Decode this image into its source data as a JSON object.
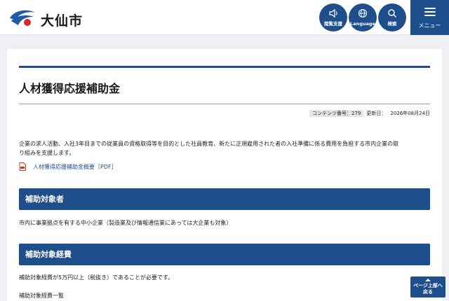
{
  "header": {
    "site_name": "大仙市",
    "buttons": {
      "reading_support": "閲覧支援",
      "language": "Language",
      "search": "検索",
      "menu": "メニュー"
    }
  },
  "page": {
    "title": "人材獲得応援補助金",
    "content_number_label": "コンテンツ番号：279",
    "updated_label": "更新日：",
    "updated_date": "2026年08月24日",
    "intro_line1": "企業の求人活動、入社3年目までの従業員の資格取得等を目的とした社員教育、新たに正規雇用された者の入社準備に係る費用を負担する市内企業の取",
    "intro_line2": "り組みを支援します。",
    "pdf_link": "人材獲得応援補助金概要［PDF］",
    "sections": [
      {
        "heading": "補助対象者",
        "text": "市内に事業拠点を有する中小企業（製造業及び情報通信業にあっては大企業も対象）"
      },
      {
        "heading": "補助対象経費",
        "text": "補助対象経費が5万円以上（税抜き）であることが必要です。",
        "text2": "補助対象経費一覧"
      }
    ]
  },
  "page_top_button": {
    "line1": "ページ上部へ",
    "line2": "戻る"
  },
  "colors": {
    "brand_navy": "#1f4e8c",
    "logo_blue": "#1e5aa8",
    "logo_red": "#d7262e"
  },
  "icons": [
    "logo-emblem",
    "speaker-icon",
    "globe-icon",
    "search-icon",
    "menu-icon",
    "pdf-icon",
    "arrow-up-icon"
  ]
}
